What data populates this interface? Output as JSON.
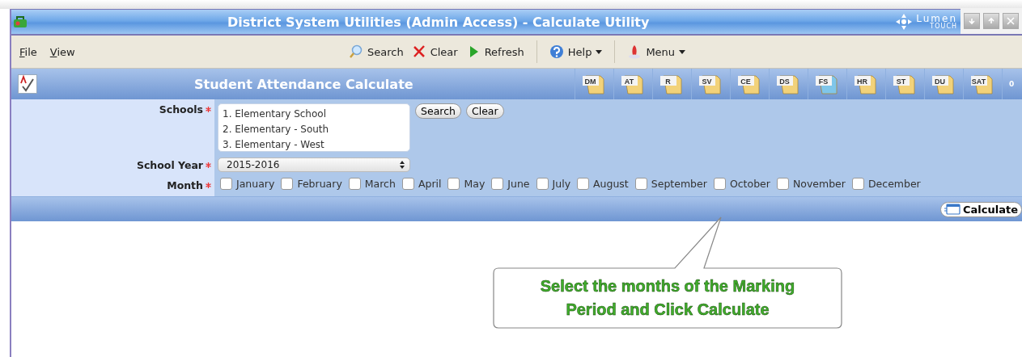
{
  "window": {
    "title": "District System Utilities (Admin Access) - Calculate Utility",
    "logo": {
      "word": "Lumen",
      "sub": "TOUCH"
    },
    "controls": [
      {
        "kind": "minimize"
      },
      {
        "kind": "maximize"
      },
      {
        "kind": "close"
      }
    ]
  },
  "menu": [
    {
      "label": "File"
    },
    {
      "label": "View"
    }
  ],
  "toolbar": [
    {
      "kind": "search",
      "label": "Search",
      "dropdown": false
    },
    {
      "kind": "clear",
      "label": "Clear",
      "dropdown": false
    },
    {
      "kind": "refresh",
      "label": "Refresh",
      "dropdown": false
    },
    {
      "kind": "help",
      "label": "Help",
      "dropdown": true
    },
    {
      "kind": "menu",
      "label": "Menu",
      "dropdown": true
    }
  ],
  "section": {
    "title": "Student Attendance Calculate",
    "folders": [
      {
        "label": "DM",
        "color": "#f2d27a"
      },
      {
        "label": "AT",
        "color": "#f2d27a"
      },
      {
        "label": "R",
        "color": "#f2d27a"
      },
      {
        "label": "SV",
        "color": "#f2d27a"
      },
      {
        "label": "CE",
        "color": "#f2d27a"
      },
      {
        "label": "DS",
        "color": "#f2d27a"
      },
      {
        "label": "FS",
        "color": "#7fc6ea"
      },
      {
        "label": "HR",
        "color": "#f2d27a"
      },
      {
        "label": "ST",
        "color": "#f2d27a"
      },
      {
        "label": "DU",
        "color": "#f2d27a"
      },
      {
        "label": "SAT",
        "color": "#f2d27a"
      }
    ],
    "overflow": "0"
  },
  "form": {
    "schools": {
      "label": "Schools",
      "required": true,
      "items": [
        {
          "index": "1.",
          "name": "Elementary School"
        },
        {
          "index": "2.",
          "name": "Elementary - South"
        },
        {
          "index": "3.",
          "name": "Elementary - West"
        }
      ],
      "buttons": [
        "Search",
        "Clear"
      ]
    },
    "school_year": {
      "label": "School Year",
      "required": true,
      "value": "2015-2016"
    },
    "month": {
      "label": "Month",
      "required": true,
      "options": [
        {
          "label": "January",
          "checked": false
        },
        {
          "label": "February",
          "checked": false
        },
        {
          "label": "March",
          "checked": false
        },
        {
          "label": "April",
          "checked": false
        },
        {
          "label": "May",
          "checked": false
        },
        {
          "label": "June",
          "checked": false
        },
        {
          "label": "July",
          "checked": false
        },
        {
          "label": "August",
          "checked": false
        },
        {
          "label": "September",
          "checked": false
        },
        {
          "label": "October",
          "checked": false
        },
        {
          "label": "November",
          "checked": false
        },
        {
          "label": "December",
          "checked": false
        }
      ]
    }
  },
  "action_button": "Calculate",
  "callout": {
    "lines": [
      "Select the months of the Marking",
      "Period and Click Calculate"
    ]
  }
}
